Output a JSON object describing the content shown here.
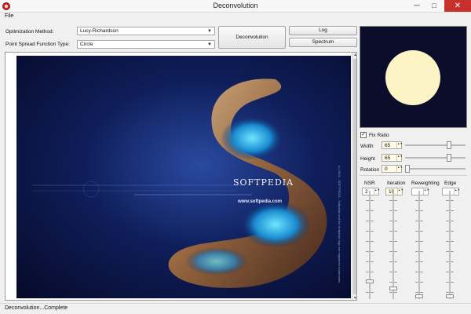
{
  "window": {
    "title": "Deconvolution",
    "minimize": "─",
    "maximize": "□",
    "close": "✕"
  },
  "menu": {
    "file": "File"
  },
  "controls": {
    "optimization_label": "Optimization Method:",
    "optimization_value": "Lucy-Richardson",
    "psf_label": "Point Spread Function Type:",
    "psf_value": "Circle",
    "deconvolution_button": "Deconvolution",
    "log_button": "Log",
    "spectrum_button": "Spectrum"
  },
  "image": {
    "brand": "SOFTPEDIA",
    "url": "www.softpedia.com",
    "side_text": "(c) 2004 - SOFTPEDIA - Softpedia and the Softpedia logo are registered trademarks"
  },
  "psf": {
    "fix_ratio_label": "Fix Ratio",
    "fix_ratio_checked": true,
    "check_mark": "✓",
    "width_label": "Width",
    "width_value": "65",
    "width_level": 0.75,
    "height_label": "Height",
    "height_value": "65",
    "height_level": 0.75,
    "rotation_label": "Rotation",
    "rotation_value": "0",
    "rotation_level": 0.0,
    "spin_arrows": "▲▼",
    "preview_color": "#0b0d2a",
    "disc_color": "#fcf4c4"
  },
  "params": [
    {
      "label": "NSR",
      "value": "2",
      "level": 0.15
    },
    {
      "label": "Iteration",
      "value": "10",
      "level": 0.08
    },
    {
      "label": "Reweighting",
      "value": "",
      "level": 0.0
    },
    {
      "label": "Edge",
      "value": "",
      "level": 0.0
    }
  ],
  "status": {
    "text": "Deconvolution...Complete"
  },
  "scroll": {
    "up": "▲",
    "down": "▼"
  }
}
